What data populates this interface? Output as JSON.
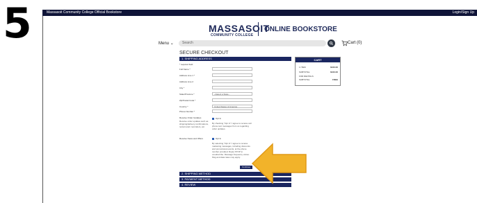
{
  "step_number": "5",
  "topbar": {
    "title": "Massasoit Community College Official Bookstore",
    "login": "Login/Sign Up"
  },
  "logo": {
    "name": "MASSASOIT",
    "sub": "COMMUNITY COLLEGE",
    "store": "ONLINE BOOKSTORE"
  },
  "nav": {
    "menu": "Menu",
    "search_placeholder": "Search",
    "cart": "Cart (0)"
  },
  "checkout": {
    "title": "SECURE CHECKOUT",
    "sections": {
      "shipping_address": "1. SHIPPING ADDRESS",
      "shipping_method": "2. SHIPPING METHOD",
      "payment_method": "3. PAYMENT METHOD",
      "review": "4. REVIEW"
    },
    "required_note": "* required field",
    "fields": [
      {
        "label": "Full Name *",
        "value": ""
      },
      {
        "label": "Address Line 1 *",
        "value": ""
      },
      {
        "label": "Address Line 2",
        "value": ""
      },
      {
        "label": "City *",
        "value": ""
      },
      {
        "label": "State/Province *",
        "value": "- Select a State -"
      },
      {
        "label": "Zip/Postal Code *",
        "value": ""
      },
      {
        "label": "Country *",
        "value": "United States of America"
      },
      {
        "label": "Phone Number *",
        "value": ""
      }
    ],
    "order_updates": {
      "label": "Receive Order Updates",
      "desc": "Receive order updates such as shipping/delivery confirmations, rental return reminders, etc.",
      "checkbox": "Opt In",
      "consent": "By checking \"Opt In\" I agree to receive cell phone text messages from us regarding order updates."
    },
    "news_offers": {
      "label": "Receive News and Offers",
      "checkbox": "Opt In",
      "consent": "By selecting \"Opt In\" I agree to receive marketing messages, including discounts and promotional events, at the phone number provided. Reply STOP to unsubscribe. Message frequency varies. Msg and data rates may apply."
    },
    "continue_button": "Continue"
  },
  "cart_summary": {
    "header": "CART",
    "rows": [
      {
        "label": "1 ITEM",
        "value": "$163.00"
      },
      {
        "label": "SUBTOTAL",
        "value": "$163.00"
      },
      {
        "label": "FOR RENTALS",
        "value": ""
      },
      {
        "label": "SUBTOTAL",
        "value": "FREE"
      }
    ]
  },
  "colors": {
    "topbar": "#0f1438",
    "navy": "#1a2660",
    "arrow": "#f2b32a"
  }
}
